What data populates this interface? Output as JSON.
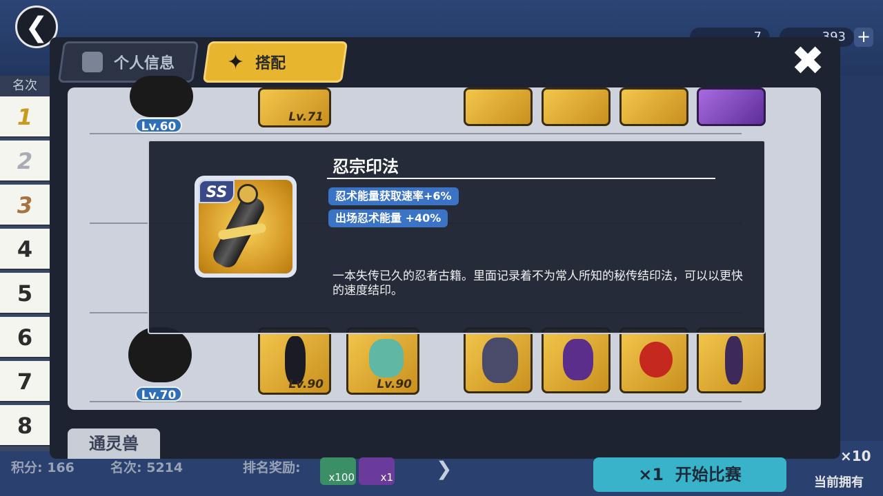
{
  "header": {
    "back_icon": "arrow-left-icon",
    "resource_1": "7",
    "resource_2": "393",
    "plus_label": "+",
    "close_icon": "close-x-icon"
  },
  "tabs": [
    {
      "label": "个人信息",
      "icon": "profile-icon"
    },
    {
      "label": "搭配",
      "icon": "shuriken-icon",
      "active": true
    }
  ],
  "rank_column": {
    "header": "名次",
    "ranks": [
      "1",
      "2",
      "3",
      "4",
      "5",
      "6",
      "7",
      "8"
    ]
  },
  "lineup_rows": [
    {
      "level": "Lv.60",
      "weapon_level": "Lv.71"
    },
    {
      "level": "Lv.60"
    },
    {
      "level": "Lv.70"
    },
    {
      "level": "Lv.70",
      "weapon_level": "Lv.90",
      "pet_level": "Lv.90"
    }
  ],
  "section_tab": "通灵兽",
  "footer": {
    "points_label": "积分:",
    "points_value": "166",
    "rank_label": "名次:",
    "rank_value": "5214",
    "reward_label": "排名奖励:",
    "reward_1_count": "x100",
    "reward_2_count": "x1",
    "start_count": "×1",
    "start_label": "开始比赛",
    "owned_count": "×10",
    "owned_label": "当前拥有"
  },
  "tooltip": {
    "title": "忍宗印法",
    "rarity": "SS",
    "stats": [
      "忍术能量获取速率+6%",
      "出场忍术能量 +40%"
    ],
    "description": "一本失传已久的忍者古籍。里面记录着不为常人所知的秘传结印法，可以以更快的速度结印。"
  },
  "colors": {
    "active_tab": "#e8b52e",
    "stat_pill": "#3b73c5",
    "level_badge": "#2f6fb7"
  }
}
